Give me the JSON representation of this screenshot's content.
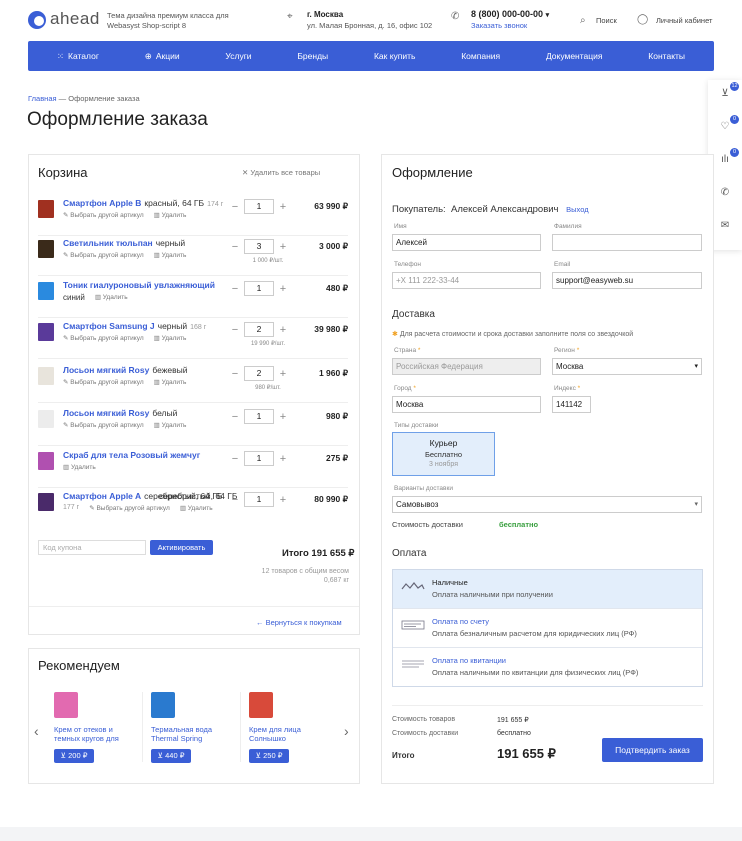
{
  "header": {
    "logo": "ahead",
    "tagline": "Тема дизайна премиум класса для Webasyst Shop-script 8",
    "city": "г. Москва",
    "address": "ул. Малая Бронная, д. 16, офис 102",
    "phone": "8 (800) 000-00-00",
    "callback": "Заказать звонок",
    "search": "Поиск",
    "account": "Личный кабинет"
  },
  "nav": [
    "Каталог",
    "Акции",
    "Услуги",
    "Бренды",
    "Как купить",
    "Компания",
    "Документация",
    "Контакты"
  ],
  "sidebar": {
    "cart_count": "12",
    "fav_count": "0",
    "compare_count": "0"
  },
  "breadcrumbs": {
    "home": "Главная",
    "sep": "—",
    "current": "Оформление заказа"
  },
  "page_title": "Оформление заказа",
  "cart": {
    "title": "Корзина",
    "clear": "Удалить все товары",
    "change_article": "Выбрать другой артикул",
    "delete": "Удалить",
    "items": [
      {
        "name": "Смартфон Apple В",
        "attr": "красный, 64 ГБ",
        "weight": "174 г",
        "qty": "1",
        "unit": "",
        "total": "63 990 ₽",
        "color": "#a03020",
        "change": true
      },
      {
        "name": "Светильник тюльпан",
        "attr": "черный",
        "weight": "",
        "qty": "3",
        "unit": "1 000 ₽/шт.",
        "total": "3 000 ₽",
        "color": "#3a2a1a",
        "change": true
      },
      {
        "name": "Тоник гиалуроновый увлажняющий",
        "attr": "синий",
        "weight": "",
        "qty": "1",
        "unit": "",
        "total": "480 ₽",
        "color": "#2a8adf",
        "change": false
      },
      {
        "name": "Смартфон Samsung J",
        "attr": "черный",
        "weight": "168 г",
        "qty": "2",
        "unit": "19 990 ₽/шт.",
        "total": "39 980 ₽",
        "color": "#5a3a9a",
        "change": true
      },
      {
        "name": "Лосьон мягкий Rosy",
        "attr": "бежевый",
        "weight": "",
        "qty": "2",
        "unit": "980 ₽/шт.",
        "total": "1 960 ₽",
        "color": "#e8e4dc",
        "change": true
      },
      {
        "name": "Лосьон мягкий Rosy",
        "attr": "белый",
        "weight": "",
        "qty": "1",
        "unit": "",
        "total": "980 ₽",
        "color": "#ececec",
        "change": true
      },
      {
        "name": "Скраб для тела Розовый жемчуг",
        "attr": "",
        "weight": "",
        "qty": "1",
        "unit": "",
        "total": "275 ₽",
        "color": "#b050b0",
        "change": false
      },
      {
        "name": "Смартфон Apple A",
        "attr": "серебристый, 64 ГБ",
        "weight": "177 г",
        "qty": "1",
        "unit": "",
        "total": "80 990 ₽",
        "color": "#4a2a6a",
        "change": true
      }
    ],
    "coupon_placeholder": "Код купона",
    "coupon_button": "Активировать",
    "total": "Итого 191 655 ₽",
    "total_sub1": "12 товаров с общим весом",
    "total_sub2": "0,687 кг",
    "back": "← Вернуться к покупкам"
  },
  "recommend": {
    "title": "Рекомендуем",
    "items": [
      {
        "name": "Крем от отеков и темных кругов для",
        "price": "200 ₽",
        "color": "#e26ab0"
      },
      {
        "name": "Термальная вода Thermal Spring",
        "price": "440 ₽",
        "color": "#2a7acf"
      },
      {
        "name": "Крем для лица Солнышко",
        "price": "250 ₽",
        "color": "#d84a3a"
      }
    ]
  },
  "checkout": {
    "title": "Оформление",
    "buyer_label": "Покупатель:",
    "buyer_name": "Алексей Александрович",
    "logout": "Выход",
    "name_label": "Имя",
    "name_value": "Алексей",
    "surname_label": "Фамилия",
    "phone_label": "Телефон",
    "phone_placeholder": "+X 111 222-33-44",
    "email_label": "Email",
    "email_value": "support@easyweb.su",
    "delivery_title": "Доставка",
    "delivery_note": "Для расчета стоимости и срока доставки заполните поля со звездочкой",
    "country_label": "Страна",
    "country_value": "Российская Федерация",
    "region_label": "Регион",
    "region_value": "Москва",
    "city_label": "Город",
    "city_value": "Москва",
    "index_label": "Индекс",
    "index_value": "141142",
    "delivery_types_label": "Типы доставки",
    "courier_title": "Курьер",
    "courier_price": "Бесплатно",
    "courier_date": "3 ноября",
    "variants_label": "Варианты доставки",
    "variant_value": "Самовывоз",
    "delivery_cost_label": "Стоимость доставки",
    "delivery_cost_value": "бесплатно",
    "payment_title": "Оплата",
    "payments": [
      {
        "name": "Наличные",
        "desc": "Оплата наличными при получении",
        "selected": true
      },
      {
        "name": "Оплата по счету",
        "desc": "Оплата безналичным расчетом для юридических лиц (РФ)",
        "selected": false
      },
      {
        "name": "Оплата по квитанции",
        "desc": "Оплата наличными по квитанции для физических лиц (РФ)",
        "selected": false
      }
    ],
    "goods_cost_label": "Стоимость товаров",
    "goods_cost_value": "191 655 ₽",
    "ship_cost_label": "Стоимость доставки",
    "ship_cost_value": "бесплатно",
    "total_label": "Итого",
    "total_value": "191 655 ₽",
    "confirm": "Подтвердить заказ"
  }
}
